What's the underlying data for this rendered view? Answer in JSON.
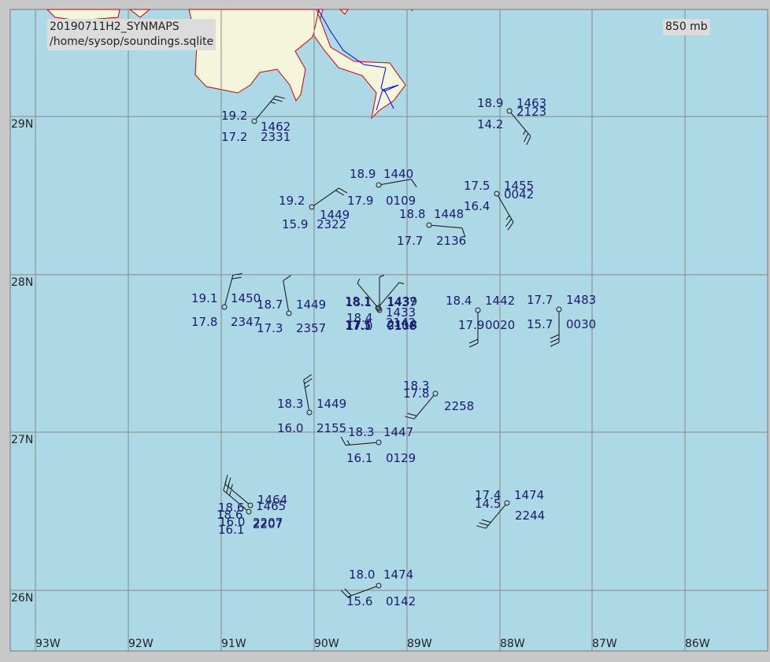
{
  "header": {
    "title": "20190711H2_SYNMAPS",
    "source": "/home/sysop/soundings.sqlite",
    "level": "850 mb"
  },
  "colors": {
    "water": "#add8e6",
    "land": "#f5f5dc",
    "coast": "#cc0000",
    "river": "#0000ff",
    "grid": "#888888",
    "station_text": "#1a1a6e"
  },
  "axes": {
    "lon_labels": [
      "93W",
      "92W",
      "91W",
      "90W",
      "89W",
      "88W",
      "87W",
      "86W"
    ],
    "lat_labels": [
      "29N",
      "28N",
      "27N",
      "26N"
    ]
  },
  "stations": [
    {
      "t": "19.2",
      "td": "17.2",
      "h": "1462",
      "w": "2331",
      "dir": 40,
      "speed": 25
    },
    {
      "t": "18.9",
      "td": "14.2",
      "h": "1463",
      "w": "2123",
      "dir": 140,
      "speed": 25
    },
    {
      "t": "18.9",
      "td": "17.9",
      "h": "1440",
      "w": "0109",
      "dir": 80,
      "speed": 10
    },
    {
      "t": "19.2",
      "td": "15.9",
      "h": "1449",
      "w": "2322",
      "dir": 55,
      "speed": 20
    },
    {
      "t": "17.5",
      "td": "16.4",
      "h": "1455",
      "w": "0042",
      "dir": 150,
      "speed": 25
    },
    {
      "t": "18.8",
      "td": "17.7",
      "h": "1448",
      "w": "2136",
      "dir": 95,
      "speed": 10
    },
    {
      "t": "19.1",
      "td": "17.8",
      "h": "1450",
      "w": "2347",
      "dir": 15,
      "speed": 20
    },
    {
      "t": "18.7",
      "td": "17.3",
      "h": "1449",
      "w": "2357",
      "dir": 350,
      "speed": 10
    },
    {
      "t": "18.1",
      "td": "17.1",
      "h": "1437",
      "w": "0108",
      "dir": 320,
      "speed": 5
    },
    {
      "t": "18.4",
      "td": "17.0",
      "h": "1433",
      "w": "2142",
      "dir": 0,
      "speed": 5
    },
    {
      "t": "18.1",
      "td": "17.5",
      "h": "1439",
      "w": "2118",
      "dir": 40,
      "speed": 5
    },
    {
      "t": "18.4",
      "td": "17.9",
      "h": "1442",
      "w": "0020",
      "dir": 180,
      "speed": 20
    },
    {
      "t": "17.7",
      "td": "15.7",
      "h": "1483",
      "w": "0030",
      "dir": 180,
      "speed": 30
    },
    {
      "t": "18.3",
      "td": "16.0",
      "h": "1449",
      "w": "2155",
      "dir": 350,
      "speed": 25
    },
    {
      "t": "18.3",
      "td": "17.8",
      "h": "",
      "w": "2258",
      "dir": 220,
      "speed": 20
    },
    {
      "t": "18.3",
      "td": "16.1",
      "h": "1447",
      "w": "0129",
      "dir": 265,
      "speed": 15
    },
    {
      "t": "18.6",
      "td": "16.1",
      "h": "1464",
      "w": "2207",
      "dir": 310,
      "speed": 25
    },
    {
      "t": "18.6",
      "td": "16.0",
      "h": "1465",
      "w": "2207",
      "dir": 310,
      "speed": 25
    },
    {
      "t": "17.4",
      "td": "14.5",
      "h": "1474",
      "w": "2244",
      "dir": 220,
      "speed": 30
    },
    {
      "t": "18.0",
      "td": "15.6",
      "h": "1474",
      "w": "0142",
      "dir": 250,
      "speed": 20
    }
  ]
}
